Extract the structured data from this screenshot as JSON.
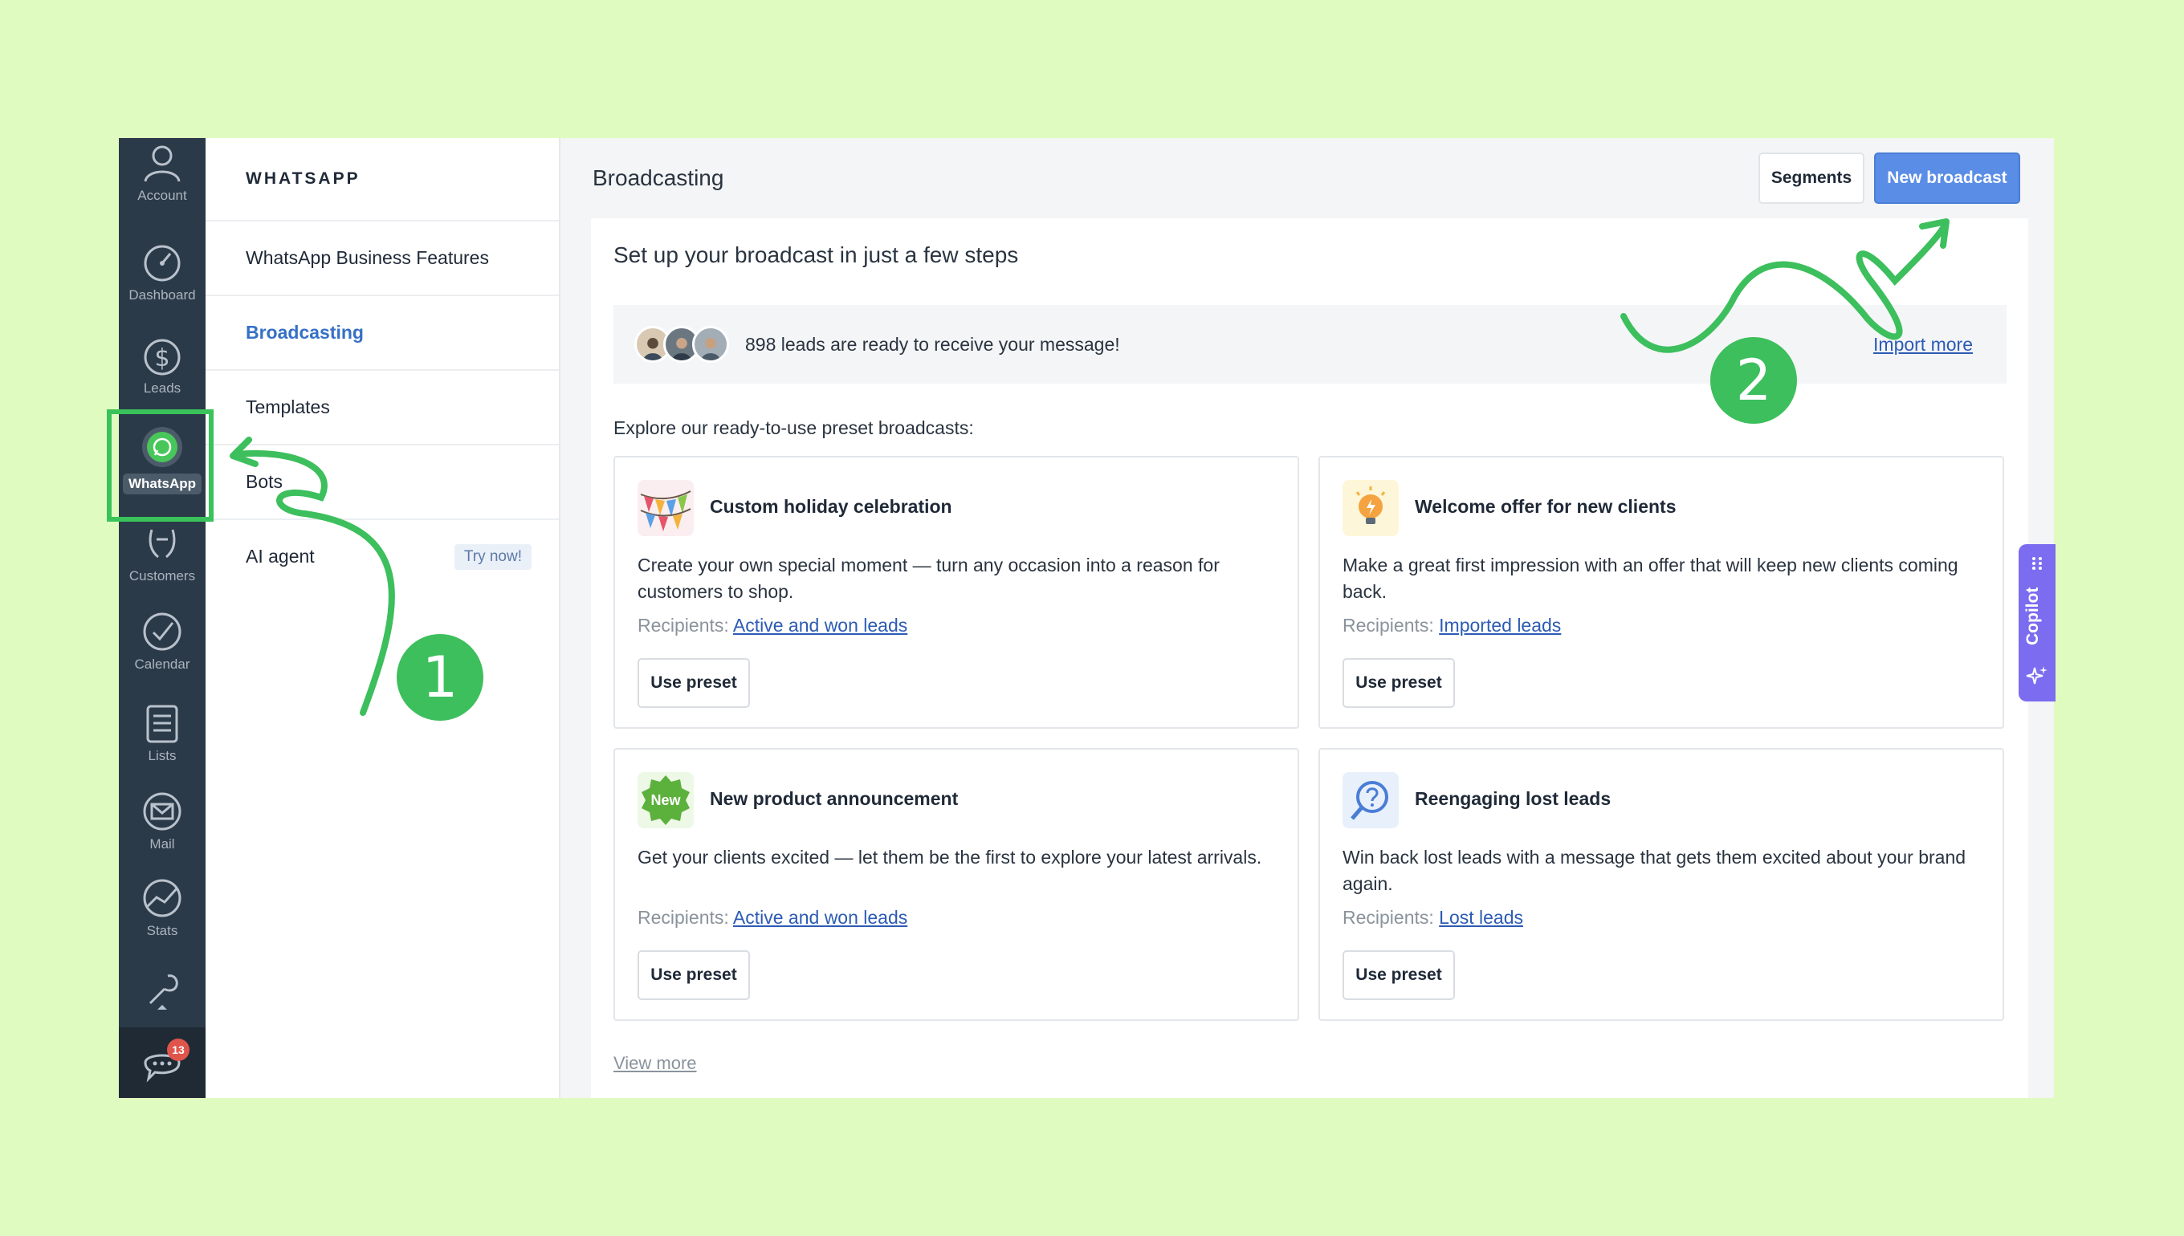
{
  "rail": {
    "items": [
      {
        "label": "Account",
        "icon": "user-icon"
      },
      {
        "label": "Dashboard",
        "icon": "gauge-icon"
      },
      {
        "label": "Leads",
        "icon": "dollar-icon"
      },
      {
        "label": "WhatsApp",
        "icon": "whatsapp-icon"
      },
      {
        "label": "Customers",
        "icon": "handshake-icon"
      },
      {
        "label": "Calendar",
        "icon": "check-icon"
      },
      {
        "label": "Lists",
        "icon": "list-icon"
      },
      {
        "label": "Mail",
        "icon": "mail-icon"
      },
      {
        "label": "Stats",
        "icon": "stats-icon"
      },
      {
        "label": "",
        "icon": "wrench-icon"
      }
    ],
    "chat_badge": "13"
  },
  "subnav": {
    "heading": "WHATSAPP",
    "items": [
      {
        "label": "WhatsApp Business Features"
      },
      {
        "label": "Broadcasting"
      },
      {
        "label": "Templates"
      },
      {
        "label": "Bots"
      },
      {
        "label": "AI agent",
        "tag": "Try now!"
      }
    ]
  },
  "main": {
    "title": "Broadcasting",
    "segments_label": "Segments",
    "new_broadcast_label": "New broadcast",
    "setup_title": "Set up your broadcast in just a few steps",
    "leads_text": "898 leads are ready to receive your message!",
    "import_link": "Import more",
    "explore_text": "Explore our ready-to-use preset broadcasts:",
    "recipients_label": "Recipients:",
    "use_preset_label": "Use preset",
    "view_more": "View more",
    "cards": [
      {
        "title": "Custom holiday celebration",
        "desc": "Create your own special moment — turn any occasion into a reason for customers to shop.",
        "recipients": "Active and won leads",
        "icon": "bunting-icon"
      },
      {
        "title": "Welcome offer for new clients",
        "desc": "Make a great first impression with an offer that will keep new clients coming back.",
        "recipients": "Imported leads",
        "icon": "lightbulb-icon"
      },
      {
        "title": "New product announcement",
        "desc": "Get your clients excited — let them be the first to explore your latest arrivals.",
        "recipients": "Active and won leads",
        "icon": "new-badge-icon",
        "icon_text": "New"
      },
      {
        "title": "Reengaging lost leads",
        "desc": "Win back lost leads with a message that gets them excited about your brand again.",
        "recipients": "Lost leads",
        "icon": "question-search-icon"
      }
    ]
  },
  "copilot": {
    "label": "Copilot"
  },
  "annotations": {
    "step1": "1",
    "step2": "2",
    "color": "#3cbf5c"
  }
}
